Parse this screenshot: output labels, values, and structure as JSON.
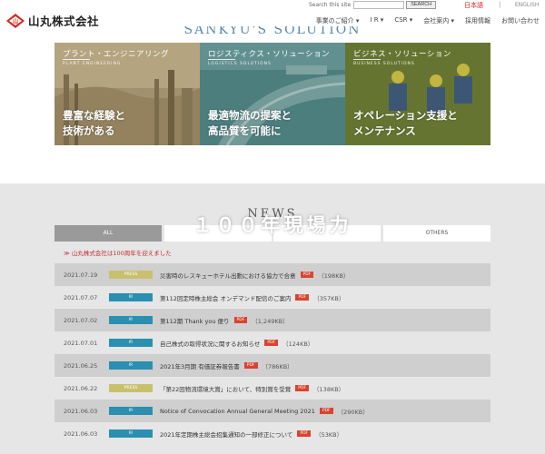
{
  "header": {
    "logo_text": "山丸株式会社",
    "search_label": "Search this site",
    "search_placeholder": "",
    "search_button": "SEARCH",
    "lang_ja": "日本語",
    "lang_sep": "|",
    "lang_en": "ENGLISH",
    "nav": [
      "事業のご紹介 ▾",
      "I R ▾",
      "CSR ▾",
      "会社案内 ▾",
      "採用情報",
      "お問い合わせ"
    ]
  },
  "solutions": {
    "title": "SANKYU'S SOLUTION",
    "panels": [
      {
        "title": "プラント・エンジニアリング",
        "sub": "PLANT ENGINEERING",
        "copy": "豊富な経験と\n技術がある"
      },
      {
        "title": "ロジスティクス・ソリューション",
        "sub": "LOGISTICS SOLUTIONS",
        "copy": "最適物流の提案と\n高品質を可能に"
      },
      {
        "title": "ビジネス・ソリューション",
        "sub": "BUSINESS SOLUTIONS",
        "copy": "オペレーション支援と\nメンテナンス"
      }
    ]
  },
  "news": {
    "title": "NEWS",
    "overlay": "１００年現場力",
    "tabs": [
      "ALL",
      "",
      "",
      "OTHERS"
    ],
    "notice": "≫ 山丸株式会社は100周年を迎えました",
    "items": [
      {
        "date": "2021.07.19",
        "tag": "PRESS",
        "title": "災害時のレスキューホテル出動における協力で合意",
        "pdf": "PDF",
        "size": "（198KB）"
      },
      {
        "date": "2021.07.07",
        "tag": "IR",
        "title": "第112回定時株主総会 オンデマンド配信のご案内",
        "pdf": "PDF",
        "size": "（357KB）"
      },
      {
        "date": "2021.07.02",
        "tag": "IR",
        "title": "第112期 Thank you 便り",
        "pdf": "PDF",
        "size": "（1,249KB）"
      },
      {
        "date": "2021.07.01",
        "tag": "IR",
        "title": "自己株式の取得状況に関するお知らせ",
        "pdf": "PDF",
        "size": "（124KB）"
      },
      {
        "date": "2021.06.25",
        "tag": "IR",
        "title": "2021年3月期 有価証券報告書",
        "pdf": "PDF",
        "size": "（786KB）"
      },
      {
        "date": "2021.06.22",
        "tag": "PRESS",
        "title": "「第22回物流環境大賞」において、特別賞を受賞",
        "pdf": "PDF",
        "size": "（138KB）"
      },
      {
        "date": "2021.06.03",
        "tag": "IR",
        "title": "Notice of Convocation Annual General Meeting 2021",
        "pdf": "PDF",
        "size": "（290KB）"
      },
      {
        "date": "2021.06.03",
        "tag": "IR",
        "title": "2021年定期株主総会招集通知の一部修正について",
        "pdf": "PDF",
        "size": "（53KB）"
      }
    ]
  },
  "colors": {
    "accent": "#d7261e",
    "press": "#c9c06e",
    "ir": "#2a8fb0",
    "pdf": "#d9442f"
  }
}
